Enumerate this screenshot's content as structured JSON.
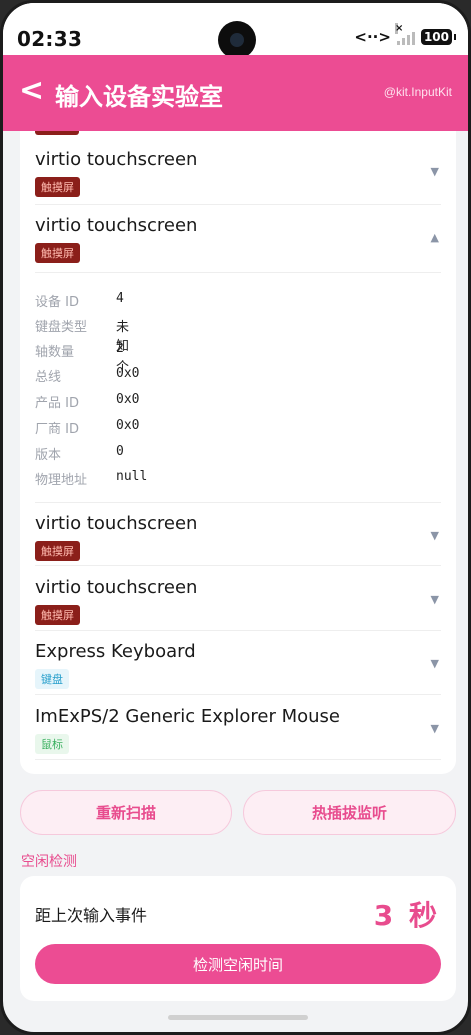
{
  "status_bar": {
    "time": "02:33",
    "network_icon": "<··>",
    "signal_x": "×",
    "battery": "100"
  },
  "header": {
    "back": "<",
    "title": "输入设备实验室",
    "subtitle": "@kit.InputKit",
    "color": "#ec4c93"
  },
  "devices": [
    {
      "name": "virtio touchscreen",
      "tag": "触摸屏",
      "expanded": false,
      "chevron": "▼"
    },
    {
      "name": "virtio touchscreen",
      "tag": "触摸屏",
      "expanded": true,
      "chevron": "▲"
    },
    {
      "name": "virtio touchscreen",
      "tag": "触摸屏",
      "expanded": false,
      "chevron": "▼"
    },
    {
      "name": "virtio touchscreen",
      "tag": "触摸屏",
      "expanded": false,
      "chevron": "▼"
    },
    {
      "name": "Express Keyboard",
      "tag": "键盘",
      "expanded": false,
      "chevron": "▼"
    },
    {
      "name": "ImExPS/2 Generic Explorer Mouse",
      "tag": "鼠标",
      "expanded": false,
      "chevron": "▼"
    }
  ],
  "details": [
    {
      "key": "设备 ID",
      "value": "4"
    },
    {
      "key": "键盘类型",
      "value": "未知"
    },
    {
      "key": "轴数量",
      "value": "2 个"
    },
    {
      "key": "总线",
      "value": "0x0"
    },
    {
      "key": "产品 ID",
      "value": "0x0"
    },
    {
      "key": "厂商 ID",
      "value": "0x0"
    },
    {
      "key": "版本",
      "value": "0"
    },
    {
      "key": "物理地址",
      "value": "null"
    }
  ],
  "actions": {
    "rescan": "重新扫描",
    "hotplug": "热插拔监听"
  },
  "idle": {
    "section_title": "空闲检测",
    "label": "距上次输入事件",
    "value": "3 秒",
    "button": "检测空闲时间"
  }
}
